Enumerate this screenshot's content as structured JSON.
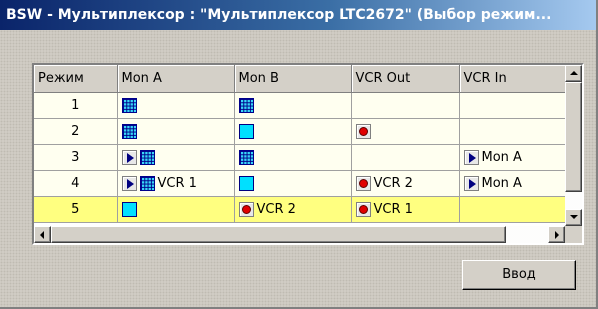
{
  "window": {
    "title": "BSW - Мультиплексор : \"Мультиплексор LTC2672\" (Выбор режим..."
  },
  "table": {
    "columns": [
      "Режим",
      "Mon A",
      "Mon B",
      "VCR Out",
      "VCR In"
    ],
    "rows": [
      {
        "mode": "1",
        "mon_a": {
          "icons": [
            "grid-icon"
          ],
          "text": ""
        },
        "mon_b": {
          "icons": [
            "grid-icon"
          ],
          "text": ""
        },
        "vcr_out": {
          "icons": [],
          "text": ""
        },
        "vcr_in": {
          "icons": [],
          "text": ""
        }
      },
      {
        "mode": "2",
        "mon_a": {
          "icons": [
            "grid-icon"
          ],
          "text": ""
        },
        "mon_b": {
          "icons": [
            "monitor-icon"
          ],
          "text": ""
        },
        "vcr_out": {
          "icons": [
            "record-icon"
          ],
          "text": ""
        },
        "vcr_in": {
          "icons": [],
          "text": ""
        }
      },
      {
        "mode": "3",
        "mon_a": {
          "icons": [
            "play-icon",
            "grid-icon"
          ],
          "text": ""
        },
        "mon_b": {
          "icons": [
            "grid-icon"
          ],
          "text": ""
        },
        "vcr_out": {
          "icons": [],
          "text": ""
        },
        "vcr_in": {
          "icons": [
            "play-icon"
          ],
          "text": "Mon A"
        }
      },
      {
        "mode": "4",
        "mon_a": {
          "icons": [
            "play-icon",
            "grid-icon"
          ],
          "text": "VCR 1"
        },
        "mon_b": {
          "icons": [
            "monitor-icon"
          ],
          "text": ""
        },
        "vcr_out": {
          "icons": [
            "record-icon"
          ],
          "text": "VCR 2"
        },
        "vcr_in": {
          "icons": [
            "play-icon"
          ],
          "text": "Mon A"
        }
      },
      {
        "mode": "5",
        "selected": true,
        "mon_a": {
          "icons": [
            "monitor-icon"
          ],
          "text": ""
        },
        "mon_b": {
          "icons": [
            "record-icon"
          ],
          "text": "VCR 2"
        },
        "vcr_out": {
          "icons": [
            "record-icon"
          ],
          "text": "VCR 1"
        },
        "vcr_in": {
          "icons": [],
          "text": ""
        }
      }
    ]
  },
  "buttons": {
    "enter_label": "Ввод"
  },
  "colors": {
    "title_bar_start": "#0a246a",
    "title_bar_end": "#a6caf0",
    "row_background": "#fffff0",
    "selected_row": "#ffff80",
    "monitor_cyan": "#00e0ff",
    "record_red": "#e00000"
  }
}
